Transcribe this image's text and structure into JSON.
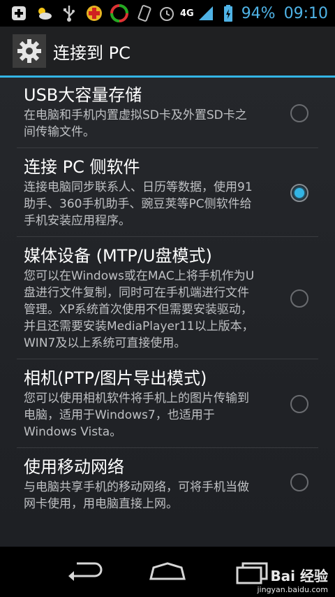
{
  "status": {
    "network": "4G",
    "battery": "94%",
    "time": "09:10",
    "accent_color": "#4fb3e6"
  },
  "header": {
    "title": "连接到 PC",
    "icon": "gear-icon"
  },
  "options": [
    {
      "title": "USB大容量存储",
      "desc": "在电脑和手机内置虚拟SD卡及外置SD卡之间传输文件。",
      "checked": false
    },
    {
      "title": "连接 PC 侧软件",
      "desc": "连接电脑同步联系人、日历等数据，使用91助手、360手机助手、豌豆荚等PC侧软件给手机安装应用程序。",
      "checked": true
    },
    {
      "title": "媒体设备 (MTP/U盘模式)",
      "desc": "您可以在Windows或在MAC上将手机作为U盘进行文件复制，同时可在手机端进行文件管理。XP系统首次使用不但需要安装驱动，并且还需要安装MediaPlayer11以上版本，WIN7及以上系统可直接使用。",
      "checked": false
    },
    {
      "title": "相机(PTP/图片导出模式)",
      "desc": "您可以使用相机软件将手机上的图片传输到电脑，适用于Windows7，也适用于Windows Vista。",
      "checked": false
    },
    {
      "title": "使用移动网络",
      "desc": "与电脑共享手机的移动网络，可将手机当做网卡使用，用电脑直接上网。",
      "checked": false
    }
  ],
  "watermark": {
    "brand": "Bai 经验",
    "url": "jingyan.baidu.com"
  }
}
